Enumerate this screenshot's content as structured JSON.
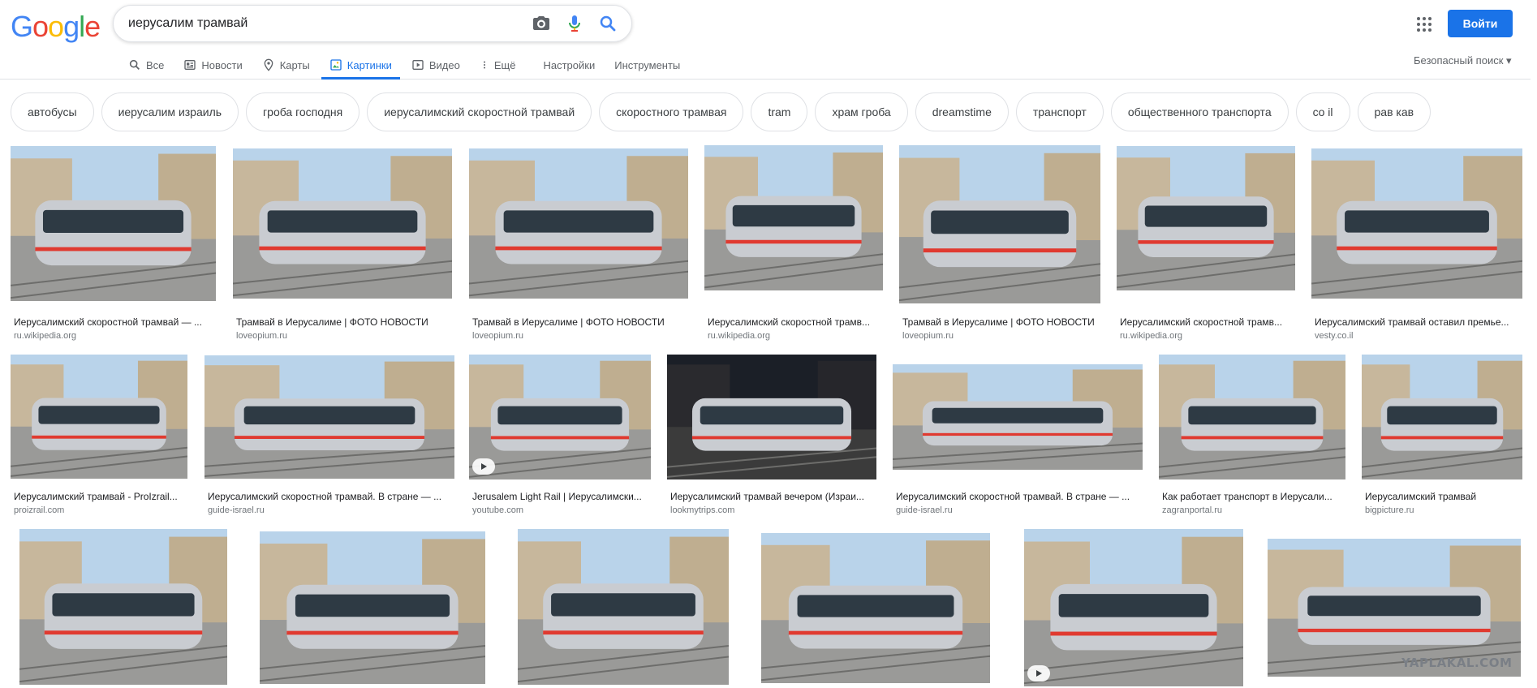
{
  "logo": {
    "letters": [
      "G",
      "o",
      "o",
      "g",
      "l",
      "e"
    ],
    "colors": [
      "#4285F4",
      "#EA4335",
      "#FBBC05",
      "#4285F4",
      "#34A853",
      "#EA4335"
    ]
  },
  "search": {
    "value": "иерусалим трамвай",
    "placeholder": ""
  },
  "tabs": [
    {
      "label": "Все",
      "icon": "search-icon"
    },
    {
      "label": "Новости",
      "icon": "news-icon"
    },
    {
      "label": "Карты",
      "icon": "map-pin-icon"
    },
    {
      "label": "Картинки",
      "icon": "image-icon",
      "active": true
    },
    {
      "label": "Видео",
      "icon": "play-icon"
    },
    {
      "label": "Ещё",
      "icon": "more-vert-icon"
    }
  ],
  "tools": {
    "settings": "Настройки",
    "tools": "Инструменты"
  },
  "header": {
    "signin": "Войти",
    "safe_search": "Безопасный поиск"
  },
  "chips": [
    "автобусы",
    "иерусалим израиль",
    "гроба господня",
    "иерусалимский скоростной трамвай",
    "скоростного трамвая",
    "tram",
    "храм гроба",
    "dreamstime",
    "транспорт",
    "общественного транспорта",
    "co il",
    "рав кав"
  ],
  "results": [
    {
      "caption": "Иерусалимский скоростной трамвай — ...",
      "source": "ru.wikipedia.org"
    },
    {
      "caption": "Трамвай в Иерусалиме | ФОТО НОВОСТИ",
      "source": "loveopium.ru"
    },
    {
      "caption": "Трамвай в Иерусалиме | ФОТО НОВОСТИ",
      "source": "loveopium.ru"
    },
    {
      "caption": "Иерусалимский скоростной трамв...",
      "source": "ru.wikipedia.org"
    },
    {
      "caption": "Трамвай в Иерусалиме | ФОТО НОВОСТИ",
      "source": "loveopium.ru"
    },
    {
      "caption": "Иерусалимский скоростной трамв...",
      "source": "ru.wikipedia.org"
    },
    {
      "caption": "Иерусалимский трамвай оставил премье...",
      "source": "vesty.co.il"
    },
    {
      "caption": "Иерусалимский трамвай - ProIzrail...",
      "source": "proizrail.com"
    },
    {
      "caption": "Иерусалимский скоростной трамвай. В стране — ...",
      "source": "guide-israel.ru"
    },
    {
      "caption": "Jerusalem Light Rail | Иерусалимски...",
      "source": "youtube.com"
    },
    {
      "caption": "Иерусалимский трамвай вечером (Израи...",
      "source": "lookmytrips.com"
    },
    {
      "caption": "Иерусалимский скоростной трамвай. В стране — ...",
      "source": "guide-israel.ru"
    },
    {
      "caption": "Как работает транспорт в Иерусали...",
      "source": "zagranportal.ru"
    },
    {
      "caption": "Иерусалимский трамвай",
      "source": "bigpicture.ru"
    },
    {
      "caption": "",
      "source": ""
    },
    {
      "caption": "",
      "source": ""
    },
    {
      "caption": "",
      "source": ""
    },
    {
      "caption": "",
      "source": ""
    },
    {
      "caption": "",
      "source": ""
    },
    {
      "caption": "",
      "source": ""
    }
  ],
  "watermark": "YAPLAKAL.COM",
  "colors": {
    "accent": "#1a73e8",
    "tram_body": "#c9ccd1",
    "window": "#2e3a44",
    "sky": "#b9d3ea",
    "ground": "#9a9a98"
  }
}
